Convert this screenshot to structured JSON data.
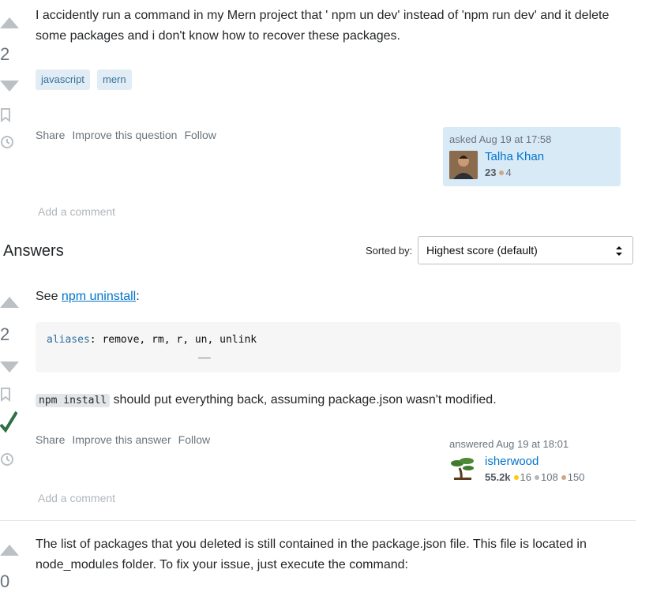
{
  "question": {
    "vote_count": "2",
    "body": "I accidently run a command in my Mern project that ' npm un dev' instead of 'npm run dev' and it delete some packages and i don't know how to recover these packages.",
    "tags": [
      "javascript",
      "mern"
    ],
    "menu": {
      "share": "Share",
      "improve": "Improve this question",
      "follow": "Follow"
    },
    "owner": {
      "asked": "asked Aug 19 at 17:58",
      "name": "Talha Khan",
      "rep": "23",
      "bronze": "4"
    },
    "add_comment": "Add a comment"
  },
  "answers_header": {
    "title": "Answers",
    "sorted_by": "Sorted by:",
    "sort_value": "Highest score (default)"
  },
  "answer1": {
    "vote_count": "2",
    "see": "See ",
    "link": "npm uninstall",
    "colon": ":",
    "code_keyword": "aliases",
    "code_rest": ": remove, rm, r, un, unlink",
    "code_marker": "__",
    "inline_code": "npm install",
    "text_after": " should put everything back, assuming package.json wasn't modified.",
    "menu": {
      "share": "Share",
      "improve": "Improve this answer",
      "follow": "Follow"
    },
    "owner": {
      "answered": "answered Aug 19 at 18:01",
      "name": "isherwood",
      "rep": "55.2k",
      "gold": "16",
      "silver": "108",
      "bronze": "150"
    },
    "add_comment": "Add a comment"
  },
  "answer2": {
    "vote_count": "0",
    "body": "The list of packages that you deleted is still contained in the package.json file. This file is located in node_modules folder. To fix your issue, just execute the command:"
  },
  "colors": {
    "link": "#0074cc",
    "tag_bg": "#e1ecf4",
    "owner_card_bg": "#d9eaf7",
    "accepted": "#2f6f44"
  },
  "icons": [
    "upvote-icon",
    "downvote-icon",
    "bookmark-icon",
    "history-icon",
    "accepted-check-icon",
    "sort-arrows-icon"
  ]
}
